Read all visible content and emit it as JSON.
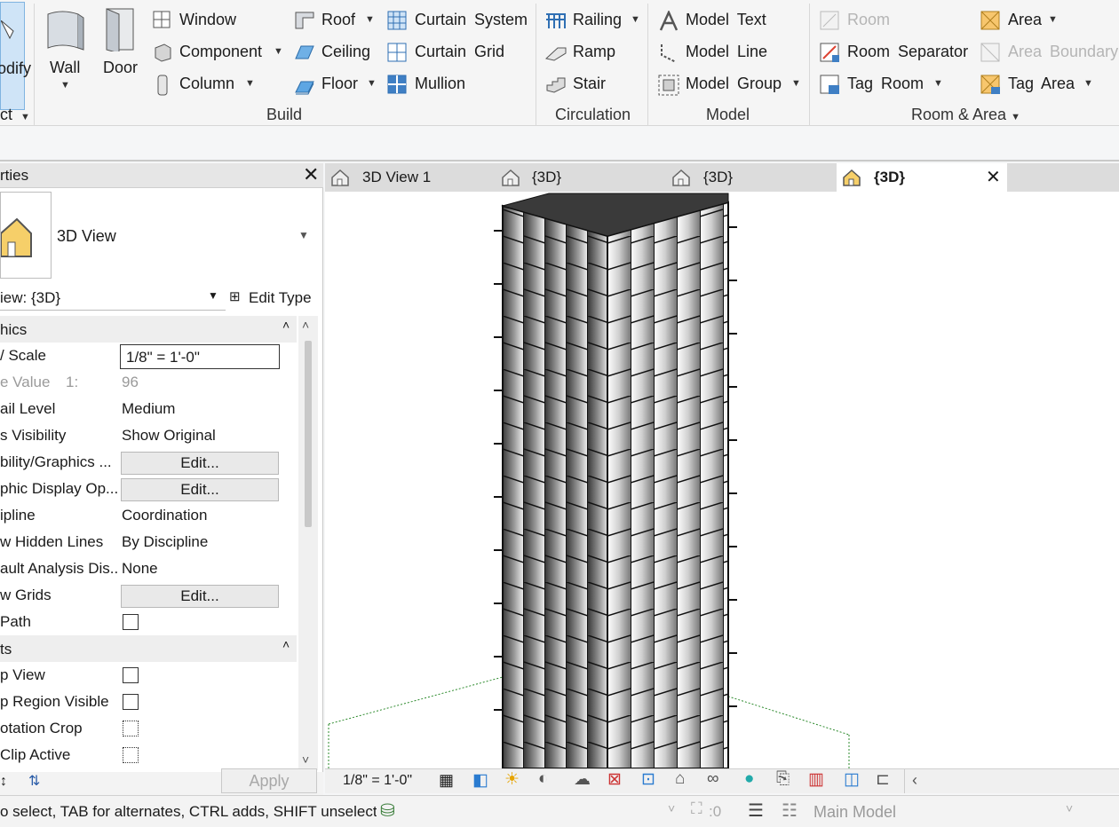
{
  "ribbon": {
    "modify_label": "odify",
    "select_label": "ct",
    "wall_label": "Wall",
    "door_label": "Door",
    "window_label": "Window",
    "component_label": "Component",
    "column_label": "Column",
    "roof_label": "Roof",
    "ceiling_label": "Ceiling",
    "floor_label": "Floor",
    "curtain_system_label": "Curtain System",
    "curtain_grid_label": "Curtain Grid",
    "mullion_label": "Mullion",
    "build_title": "Build",
    "railing_label": "Railing",
    "ramp_label": "Ramp",
    "stair_label": "Stair",
    "circulation_title": "Circulation",
    "model_text_label": "Model Text",
    "model_line_label": "Model Line",
    "model_group_label": "Model Group",
    "model_title": "Model",
    "room_label": "Room",
    "room_separator_label": "Room Separator",
    "tag_room_label": "Tag Room",
    "area_label": "Area",
    "area_boundary_label": "Area Boundary",
    "tag_area_label": "Tag Area",
    "room_area_title": "Room & Area"
  },
  "properties": {
    "title": "rties",
    "type_name": "3D View",
    "view_selector": "iew: {3D}",
    "edit_type": "Edit Type",
    "graphics_group": "hics",
    "extents_group": "ts",
    "rows": [
      {
        "key": "/ Scale",
        "value": "1/8\" = 1'-0\""
      },
      {
        "key": "e Value",
        "key2": "1:",
        "value": "96"
      },
      {
        "key": "ail Level",
        "value": "Medium"
      },
      {
        "key": "s Visibility",
        "value": "Show Original"
      },
      {
        "key": "bility/Graphics ...",
        "value": "Edit..."
      },
      {
        "key": "phic Display Op...",
        "value": "Edit..."
      },
      {
        "key": "ipline",
        "value": "Coordination"
      },
      {
        "key": "w Hidden Lines",
        "value": "By Discipline"
      },
      {
        "key": "ault Analysis Dis...",
        "value": "None"
      },
      {
        "key": "w Grids",
        "value": "Edit..."
      },
      {
        "key": "Path",
        "value": ""
      }
    ],
    "extent_rows": [
      {
        "key": "p View"
      },
      {
        "key": "p Region Visible"
      },
      {
        "key": "otation Crop"
      },
      {
        "key": "Clip Active"
      }
    ],
    "apply": "Apply"
  },
  "tabs": [
    {
      "label": "3D View 1"
    },
    {
      "label": "{3D}"
    },
    {
      "label": "{3D}"
    },
    {
      "label": "{3D}"
    }
  ],
  "view_bar": {
    "scale": "1/8\" = 1'-0\""
  },
  "status": {
    "hint": "o select, TAB for alternates, CTRL adds, SHIFT unselect",
    "worksets": ":0",
    "model": "Main Model"
  }
}
